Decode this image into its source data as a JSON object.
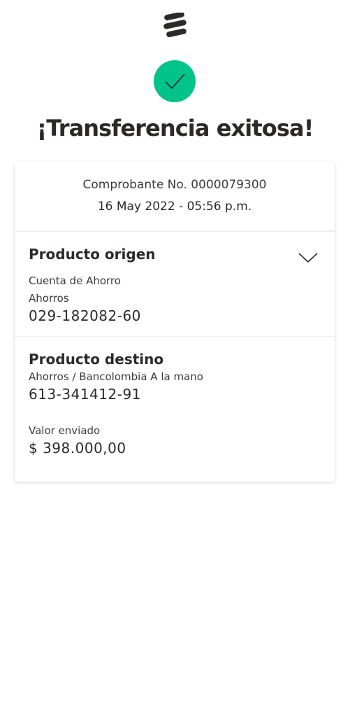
{
  "header": {
    "logo_icon": "bancolombia-logo-icon",
    "status_icon": "check-circle-icon",
    "status_color": "#00c389",
    "title": "¡Transferencia exitosa!"
  },
  "receipt": {
    "number": "Comprobante No. 0000079300",
    "date": "16 May 2022 - 05:56 p.m."
  },
  "origin": {
    "title": "Producto origen",
    "account_type": "Cuenta de Ahorro",
    "account_name": "Ahorros",
    "account_number": "029-182082-60",
    "expand_icon": "chevron-down-icon"
  },
  "destination": {
    "title": "Producto destino",
    "account_name": "Ahorros / Bancolombia A la mano",
    "account_number": "613-341412-91",
    "amount_label": "Valor enviado",
    "amount": "$ 398.000,00"
  }
}
